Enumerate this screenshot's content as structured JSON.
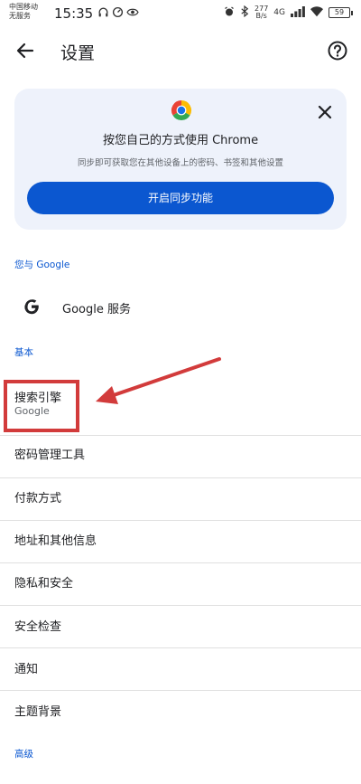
{
  "status_bar": {
    "carrier_line1": "中国移动",
    "carrier_line2": "无服务",
    "time": "15:35",
    "speed_value": "277",
    "speed_unit": "B/s",
    "network": "4G",
    "battery": "59"
  },
  "app_bar": {
    "title": "设置"
  },
  "sync_card": {
    "title": "按您自己的方式使用 Chrome",
    "description": "同步即可获取您在其他设备上的密码、书签和其他设置",
    "button_label": "开启同步功能"
  },
  "sections": {
    "you_and_google": "您与 Google",
    "basics": "基本",
    "advanced": "高级"
  },
  "google_services": {
    "label": "Google 服务"
  },
  "settings_items": [
    {
      "label": "搜索引擎",
      "sub": "Google"
    },
    {
      "label": "密码管理工具"
    },
    {
      "label": "付款方式"
    },
    {
      "label": "地址和其他信息"
    },
    {
      "label": "隐私和安全"
    },
    {
      "label": "安全检查"
    },
    {
      "label": "通知"
    },
    {
      "label": "主题背景"
    }
  ],
  "colors": {
    "accent": "#0b57d0",
    "card_bg": "#eef2fb",
    "annotation_red": "#d23b3b"
  },
  "icons": [
    "back-arrow-icon",
    "help-circle-icon",
    "chrome-logo-icon",
    "close-icon",
    "google-g-icon"
  ]
}
